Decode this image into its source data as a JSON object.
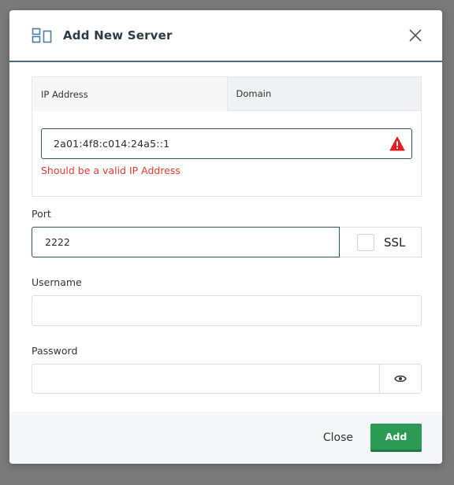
{
  "modal": {
    "title": "Add New Server",
    "header_icon": "servers-icon",
    "close_icon": "close-icon"
  },
  "address_tabs": [
    {
      "label": "IP Address",
      "active": true
    },
    {
      "label": "Domain",
      "active": false
    }
  ],
  "ip_field": {
    "value": "2a01:4f8:c014:24a5::1",
    "error_icon": "warning-icon",
    "error_message": "Should be a valid IP Address",
    "error_color": "#e23a32"
  },
  "port": {
    "label": "Port",
    "value": "2222",
    "ssl_label": "SSL",
    "ssl_checked": false
  },
  "username": {
    "label": "Username",
    "value": ""
  },
  "password": {
    "label": "Password",
    "value": "",
    "toggle_icon": "eye-icon"
  },
  "footer": {
    "close_label": "Close",
    "add_label": "Add",
    "add_color": "#2b9a54"
  }
}
